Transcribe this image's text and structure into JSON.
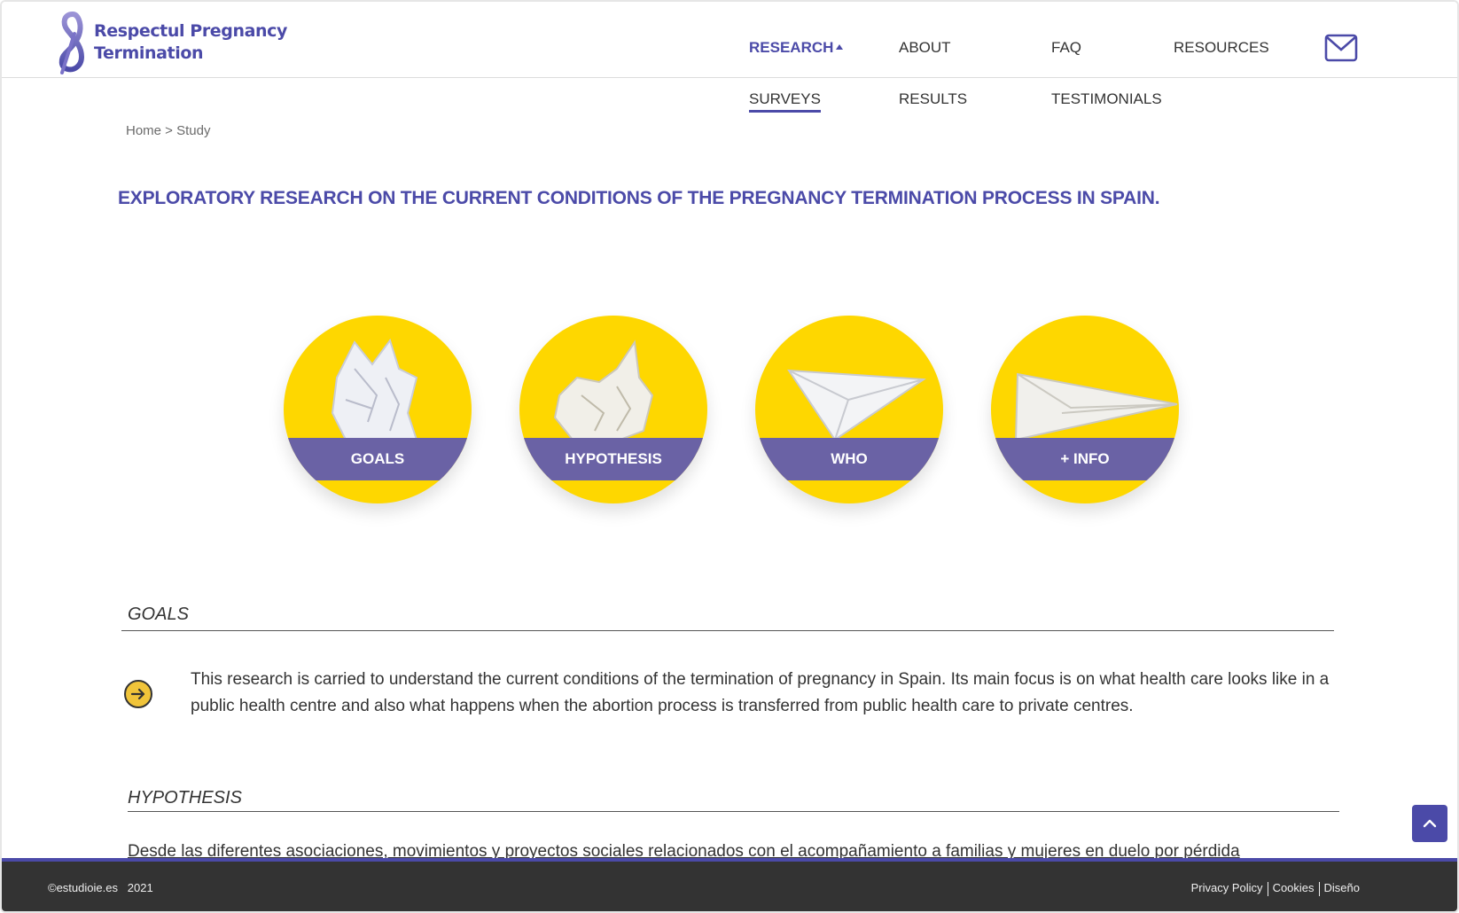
{
  "brand": {
    "line1": "Respectul Pregnancy",
    "line2": "Termination"
  },
  "nav": {
    "research": "RESEARCH",
    "about": "ABOUT",
    "faq": "FAQ",
    "resources": "RESOURCES"
  },
  "subnav": {
    "surveys": "SURVEYS",
    "results": "RESULTS",
    "testimonials": "TESTIMONIALS"
  },
  "breadcrumb": "Home > Study",
  "page_title": "EXPLORATORY RESEARCH ON THE CURRENT CONDITIONS OF THE PREGNANCY TERMINATION PROCESS IN SPAIN.",
  "cards": [
    {
      "label": "GOALS"
    },
    {
      "label": "HYPOTHESIS"
    },
    {
      "label": "WHO"
    },
    {
      "label": "+ INFO"
    }
  ],
  "goals": {
    "title": "GOALS",
    "text": "This research is carried to understand the current conditions of the termination of pregnancy in Spain. Its main focus is on what health care looks like in a public health centre and also what happens when the abortion process is transferred from public health care to private centres."
  },
  "hypothesis": {
    "title": "HYPOTHESIS",
    "text": "Desde las diferentes asociaciones, movimientos y proyectos sociales relacionados con el acompañamiento a familias y mujeres en duelo por pérdida"
  },
  "footer": {
    "copyright": "©estudioie.es   2021",
    "privacy": "Privacy Policy",
    "cookies": "Cookies",
    "design": "Diseño"
  },
  "colors": {
    "brand": "#4b4aa8",
    "yellow": "#fed700",
    "band": "#6a62a5",
    "footer": "#333333"
  },
  "icons": [
    "ribbon-logo-icon",
    "caret-up-icon",
    "mail-icon",
    "arrow-right-circle-icon",
    "chevron-up-icon"
  ]
}
